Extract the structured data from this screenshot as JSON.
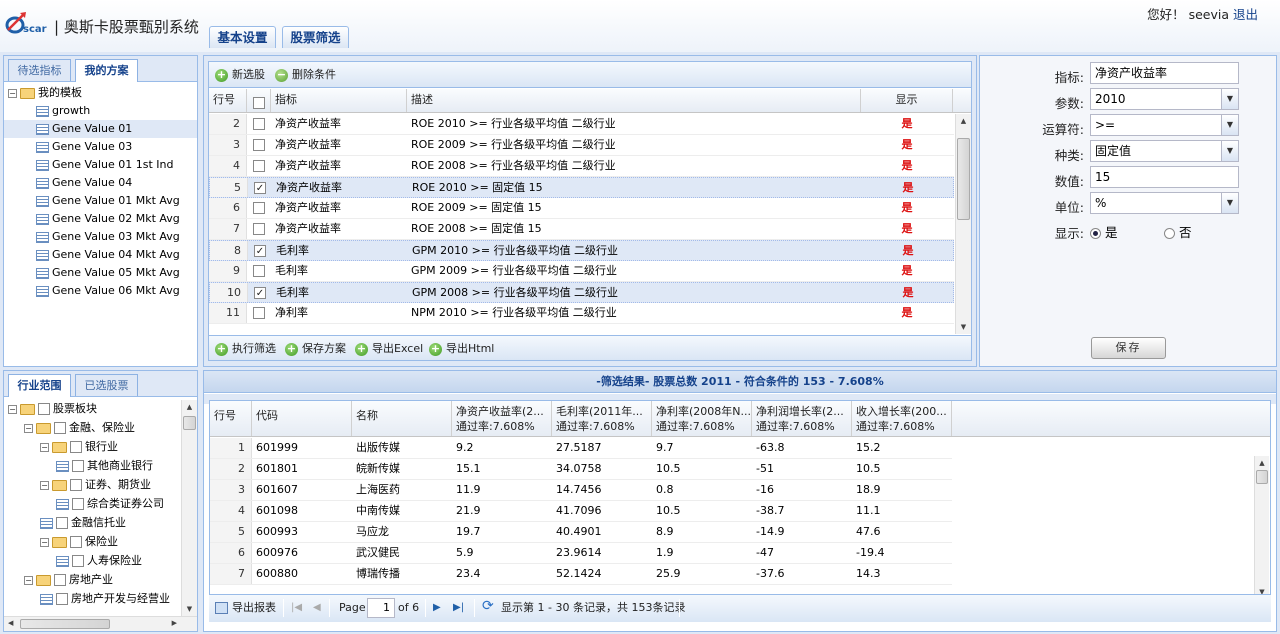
{
  "app": {
    "logo_text": "Oscar",
    "title": "奥斯卡股票甄别系统"
  },
  "nav_tabs": [
    "基本设置",
    "股票筛选"
  ],
  "user": {
    "greeting": "您好！",
    "name": "seevia",
    "logout": "退出"
  },
  "left_top": {
    "tabs": [
      "待选指标",
      "我的方案"
    ],
    "active_tab": 1,
    "tree": [
      {
        "label": "我的模板",
        "level": 0,
        "type": "folder",
        "expanded": true
      },
      {
        "label": "growth",
        "level": 1,
        "type": "leaf"
      },
      {
        "label": "Gene Value 01",
        "level": 1,
        "type": "leaf",
        "selected": true
      },
      {
        "label": "Gene Value 03",
        "level": 1,
        "type": "leaf"
      },
      {
        "label": "Gene Value 01 1st Ind",
        "level": 1,
        "type": "leaf"
      },
      {
        "label": "Gene Value 04",
        "level": 1,
        "type": "leaf"
      },
      {
        "label": "Gene Value 01 Mkt Avg",
        "level": 1,
        "type": "leaf"
      },
      {
        "label": "Gene Value 02 Mkt Avg",
        "level": 1,
        "type": "leaf"
      },
      {
        "label": "Gene Value 03 Mkt Avg",
        "level": 1,
        "type": "leaf"
      },
      {
        "label": "Gene Value 04 Mkt Avg",
        "level": 1,
        "type": "leaf"
      },
      {
        "label": "Gene Value 05 Mkt Avg",
        "level": 1,
        "type": "leaf"
      },
      {
        "label": "Gene Value 06 Mkt Avg",
        "level": 1,
        "type": "leaf"
      }
    ]
  },
  "left_bottom": {
    "tabs": [
      "行业范围",
      "已选股票"
    ],
    "active_tab": 0,
    "tree": [
      {
        "label": "股票板块",
        "level": 0,
        "type": "folder"
      },
      {
        "label": "金融、保险业",
        "level": 1,
        "type": "folder"
      },
      {
        "label": "银行业",
        "level": 2,
        "type": "folder"
      },
      {
        "label": "其他商业银行",
        "level": 3,
        "type": "leaf"
      },
      {
        "label": "证券、期货业",
        "level": 2,
        "type": "folder"
      },
      {
        "label": "综合类证券公司",
        "level": 3,
        "type": "leaf"
      },
      {
        "label": "金融信托业",
        "level": 2,
        "type": "leaf"
      },
      {
        "label": "保险业",
        "level": 2,
        "type": "folder"
      },
      {
        "label": "人寿保险业",
        "level": 3,
        "type": "leaf"
      },
      {
        "label": "房地产业",
        "level": 1,
        "type": "folder"
      },
      {
        "label": "房地产开发与经营业",
        "level": 2,
        "type": "leaf"
      }
    ]
  },
  "conditions": {
    "toolbar": {
      "add": "新选股",
      "remove": "删除条件"
    },
    "columns": [
      "行号",
      "",
      "指标",
      "描述",
      "显示"
    ],
    "rows": [
      {
        "no": "2",
        "checked": false,
        "metric": "净资产收益率",
        "desc": "ROE 2010 >= 行业各级平均值 二级行业",
        "show": "是"
      },
      {
        "no": "3",
        "checked": false,
        "metric": "净资产收益率",
        "desc": "ROE 2009 >= 行业各级平均值 二级行业",
        "show": "是"
      },
      {
        "no": "4",
        "checked": false,
        "metric": "净资产收益率",
        "desc": "ROE 2008 >= 行业各级平均值 二级行业",
        "show": "是"
      },
      {
        "no": "5",
        "checked": true,
        "metric": "净资产收益率",
        "desc": "ROE 2010 >= 固定值 15",
        "show": "是"
      },
      {
        "no": "6",
        "checked": false,
        "metric": "净资产收益率",
        "desc": "ROE 2009 >= 固定值 15",
        "show": "是"
      },
      {
        "no": "7",
        "checked": false,
        "metric": "净资产收益率",
        "desc": "ROE 2008 >= 固定值 15",
        "show": "是"
      },
      {
        "no": "8",
        "checked": true,
        "metric": "毛利率",
        "desc": "GPM 2010 >= 行业各级平均值 二级行业",
        "show": "是"
      },
      {
        "no": "9",
        "checked": false,
        "metric": "毛利率",
        "desc": "GPM 2009 >= 行业各级平均值 二级行业",
        "show": "是"
      },
      {
        "no": "10",
        "checked": true,
        "metric": "毛利率",
        "desc": "GPM 2008 >= 行业各级平均值 二级行业",
        "show": "是"
      },
      {
        "no": "11",
        "checked": false,
        "metric": "净利率",
        "desc": "NPM 2010 >= 行业各级平均值 二级行业",
        "show": "是"
      }
    ],
    "bottom_toolbar": [
      "执行筛选",
      "保存方案",
      "导出Excel",
      "导出Html"
    ]
  },
  "form": {
    "metric_label": "指标:",
    "metric_value": "净资产收益率",
    "param_label": "参数:",
    "param_value": "2010",
    "op_label": "运算符:",
    "op_value": ">=",
    "type_label": "种类:",
    "type_value": "固定值",
    "num_label": "数值:",
    "num_value": "15",
    "unit_label": "单位:",
    "unit_value": "%",
    "show_label": "显示:",
    "yes": "是",
    "no": "否",
    "show_selected": "yes",
    "save": "保存"
  },
  "results": {
    "header": "-筛选结果- 股票总数 2011 - 符合条件的 153 - 7.608%",
    "columns": [
      {
        "l1": "行号",
        "l2": ""
      },
      {
        "l1": "代码",
        "l2": ""
      },
      {
        "l1": "名称",
        "l2": ""
      },
      {
        "l1": "净资产收益率(2...",
        "l2": "通过率:7.608%"
      },
      {
        "l1": "毛利率(2011年...",
        "l2": "通过率:7.608%"
      },
      {
        "l1": "净利率(2008年N...",
        "l2": "通过率:7.608%"
      },
      {
        "l1": "净利润增长率(2...",
        "l2": "通过率:7.608%"
      },
      {
        "l1": "收入增长率(200...",
        "l2": "通过率:7.608%"
      }
    ],
    "rows": [
      [
        "1",
        "601999",
        "出版传媒",
        "9.2",
        "27.5187",
        "9.7",
        "-63.8",
        "15.2"
      ],
      [
        "2",
        "601801",
        "皖新传媒",
        "15.1",
        "34.0758",
        "10.5",
        "-51",
        "10.5"
      ],
      [
        "3",
        "601607",
        "上海医药",
        "11.9",
        "14.7456",
        "0.8",
        "-16",
        "18.9"
      ],
      [
        "4",
        "601098",
        "中南传媒",
        "21.9",
        "41.7096",
        "10.5",
        "-38.7",
        "11.1"
      ],
      [
        "5",
        "600993",
        "马应龙",
        "19.7",
        "40.4901",
        "8.9",
        "-14.9",
        "47.6"
      ],
      [
        "6",
        "600976",
        "武汉健民",
        "5.9",
        "23.9614",
        "1.9",
        "-47",
        "-19.4"
      ],
      [
        "7",
        "600880",
        "博瑞传播",
        "23.4",
        "52.1424",
        "25.9",
        "-37.6",
        "14.3"
      ]
    ],
    "pager": {
      "export": "导出报表",
      "page_label": "Page",
      "page": "1",
      "of": "of 6",
      "info": "显示第 1 - 30 条记录，共 153条记录"
    }
  }
}
